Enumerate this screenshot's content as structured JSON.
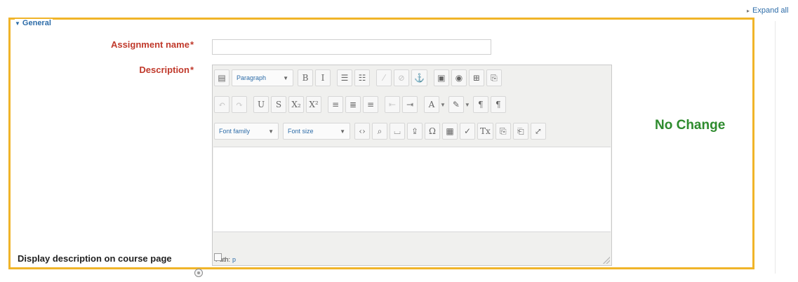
{
  "header": {
    "expand_all": "Expand all"
  },
  "section": {
    "legend": "General"
  },
  "form": {
    "assignment_name_label": "Assignment name",
    "description_label": "Description",
    "required_mark": "*",
    "assignment_name_value": "",
    "display_description_label": "Display description on course page",
    "display_description_checked": false
  },
  "editor": {
    "format_select": "Paragraph",
    "font_family_select": "Font family",
    "font_size_select": "Font size",
    "path_label": "Path:",
    "path_value": "p",
    "toolbar_row1": [
      {
        "name": "toggle-toolbar-icon",
        "glyph": "▤"
      },
      {
        "name": "bold-icon",
        "glyph": "B"
      },
      {
        "name": "italic-icon",
        "glyph": "I"
      },
      {
        "name": "bullet-list-icon",
        "glyph": "☰"
      },
      {
        "name": "numbered-list-icon",
        "glyph": "☷"
      },
      {
        "name": "link-icon",
        "glyph": "⁄"
      },
      {
        "name": "unlink-icon",
        "glyph": "⊘"
      },
      {
        "name": "anchor-icon",
        "glyph": "⚓"
      },
      {
        "name": "image-icon",
        "glyph": "▣"
      },
      {
        "name": "media-icon",
        "glyph": "◉"
      },
      {
        "name": "word-paste-icon",
        "glyph": "⊞"
      },
      {
        "name": "paste-icon",
        "glyph": "⎘"
      }
    ],
    "toolbar_row2": [
      {
        "name": "undo-icon",
        "glyph": "↶"
      },
      {
        "name": "redo-icon",
        "glyph": "↷"
      },
      {
        "name": "underline-icon",
        "glyph": "U"
      },
      {
        "name": "strikethrough-icon",
        "glyph": "S"
      },
      {
        "name": "subscript-icon",
        "glyph": "X₂"
      },
      {
        "name": "superscript-icon",
        "glyph": "X²"
      },
      {
        "name": "align-left-icon",
        "glyph": "≡"
      },
      {
        "name": "align-center-icon",
        "glyph": "≣"
      },
      {
        "name": "align-right-icon",
        "glyph": "≡"
      },
      {
        "name": "outdent-icon",
        "glyph": "⇤"
      },
      {
        "name": "indent-icon",
        "glyph": "⇥"
      },
      {
        "name": "text-color-icon",
        "glyph": "A"
      },
      {
        "name": "background-color-icon",
        "glyph": "✎"
      },
      {
        "name": "ltr-icon",
        "glyph": "¶"
      },
      {
        "name": "rtl-icon",
        "glyph": "¶"
      }
    ],
    "toolbar_row3": [
      {
        "name": "code-icon",
        "glyph": "‹›"
      },
      {
        "name": "find-replace-icon",
        "glyph": "⌕"
      },
      {
        "name": "non-breaking-space-icon",
        "glyph": "⌴"
      },
      {
        "name": "upload-icon",
        "glyph": "⇪"
      },
      {
        "name": "special-char-icon",
        "glyph": "Ω"
      },
      {
        "name": "table-icon",
        "glyph": "▦"
      },
      {
        "name": "spellcheck-icon",
        "glyph": "✓"
      },
      {
        "name": "clear-formatting-icon",
        "glyph": "Tx"
      },
      {
        "name": "paste-text-icon",
        "glyph": "⎘"
      },
      {
        "name": "paste-word-icon",
        "glyph": "⎗"
      },
      {
        "name": "fullscreen-icon",
        "glyph": "⤢"
      }
    ]
  },
  "annotation": {
    "no_change": "No Change"
  },
  "colors": {
    "highlight_border": "#f0b429",
    "required_label": "#c0392b",
    "annotation_text": "#2e8b2e",
    "link": "#2d6ca8"
  }
}
